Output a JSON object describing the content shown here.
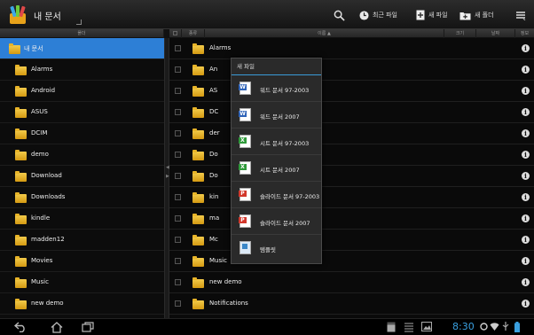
{
  "topbar": {
    "title": "내 문서",
    "actions": [
      {
        "label": "",
        "icon": "search-icon"
      },
      {
        "label": "최근 파일",
        "icon": "clock-icon"
      },
      {
        "label": "새 파일",
        "icon": "new-file-icon"
      },
      {
        "label": "새 폴더",
        "icon": "new-folder-icon"
      },
      {
        "label": "",
        "icon": "overflow-menu-icon"
      }
    ]
  },
  "left_header": {
    "label": "폴더"
  },
  "right_header": {
    "type": "종류",
    "name": "이름 ▲",
    "size": "크기",
    "date": "날짜",
    "info": "정보"
  },
  "folders": [
    {
      "label": "내 문서",
      "selected": true
    },
    {
      "label": "Alarms"
    },
    {
      "label": "Android"
    },
    {
      "label": "ASUS"
    },
    {
      "label": "DCIM"
    },
    {
      "label": "demo"
    },
    {
      "label": "Download"
    },
    {
      "label": "Downloads"
    },
    {
      "label": "kindle"
    },
    {
      "label": "madden12"
    },
    {
      "label": "Movies"
    },
    {
      "label": "Music"
    },
    {
      "label": "new demo"
    }
  ],
  "files": [
    {
      "label": "Alarms"
    },
    {
      "label": "An"
    },
    {
      "label": "AS"
    },
    {
      "label": "DC"
    },
    {
      "label": "der"
    },
    {
      "label": "Do"
    },
    {
      "label": "Do"
    },
    {
      "label": "kin"
    },
    {
      "label": "ma"
    },
    {
      "label": "Mc"
    },
    {
      "label": "Music"
    },
    {
      "label": "new demo"
    },
    {
      "label": "Notifications"
    }
  ],
  "new_file_menu": {
    "title": "새 파일",
    "items": [
      {
        "label": "워드 문서 97-2003",
        "icon": "word-doc-icon",
        "color": "#2e63b8",
        "glyph": "W"
      },
      {
        "label": "워드 문서 2007",
        "icon": "word-docx-icon",
        "color": "#2e63b8",
        "glyph": "W"
      },
      {
        "label": "시트 문서 97-2003",
        "icon": "sheet-xls-icon",
        "color": "#2f9a3a",
        "glyph": "X"
      },
      {
        "label": "시트 문서 2007",
        "icon": "sheet-xlsx-icon",
        "color": "#2f9a3a",
        "glyph": "X"
      },
      {
        "label": "슬라이드 문서 97-2003",
        "icon": "slide-ppt-icon",
        "color": "#d2372b",
        "glyph": "P"
      },
      {
        "label": "슬라이드 문서 2007",
        "icon": "slide-pptx-icon",
        "color": "#d2372b",
        "glyph": "P"
      },
      {
        "label": "템플릿",
        "icon": "template-icon",
        "color": "#3a87c8",
        "glyph": ""
      }
    ]
  },
  "statusbar": {
    "time": "8:30"
  },
  "colors": {
    "selection": "#2d7fd6",
    "clock": "#3aa0e0"
  }
}
